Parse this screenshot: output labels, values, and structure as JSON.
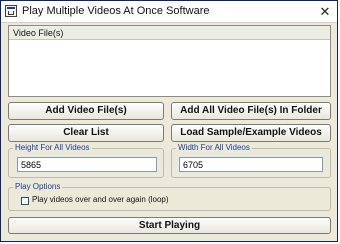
{
  "window": {
    "title": "Play Multiple Videos At Once Software",
    "close_glyph": "✕"
  },
  "list": {
    "header": "Video File(s)"
  },
  "buttons": {
    "add_files": "Add Video File(s)",
    "add_all_folder": "Add All Video File(s) In Folder",
    "clear_list": "Clear List",
    "load_sample": "Load Sample/Example Videos",
    "start": "Start Playing"
  },
  "height_group": {
    "legend": "Height For All Videos",
    "value": "5865"
  },
  "width_group": {
    "legend": "Width For All Videos",
    "value": "6705"
  },
  "play_options": {
    "legend": "Play Options",
    "loop_label": "Play videos over and over again (loop)",
    "loop_checked": false
  },
  "icons": {
    "app": "app-window-icon",
    "close": "close-icon"
  }
}
